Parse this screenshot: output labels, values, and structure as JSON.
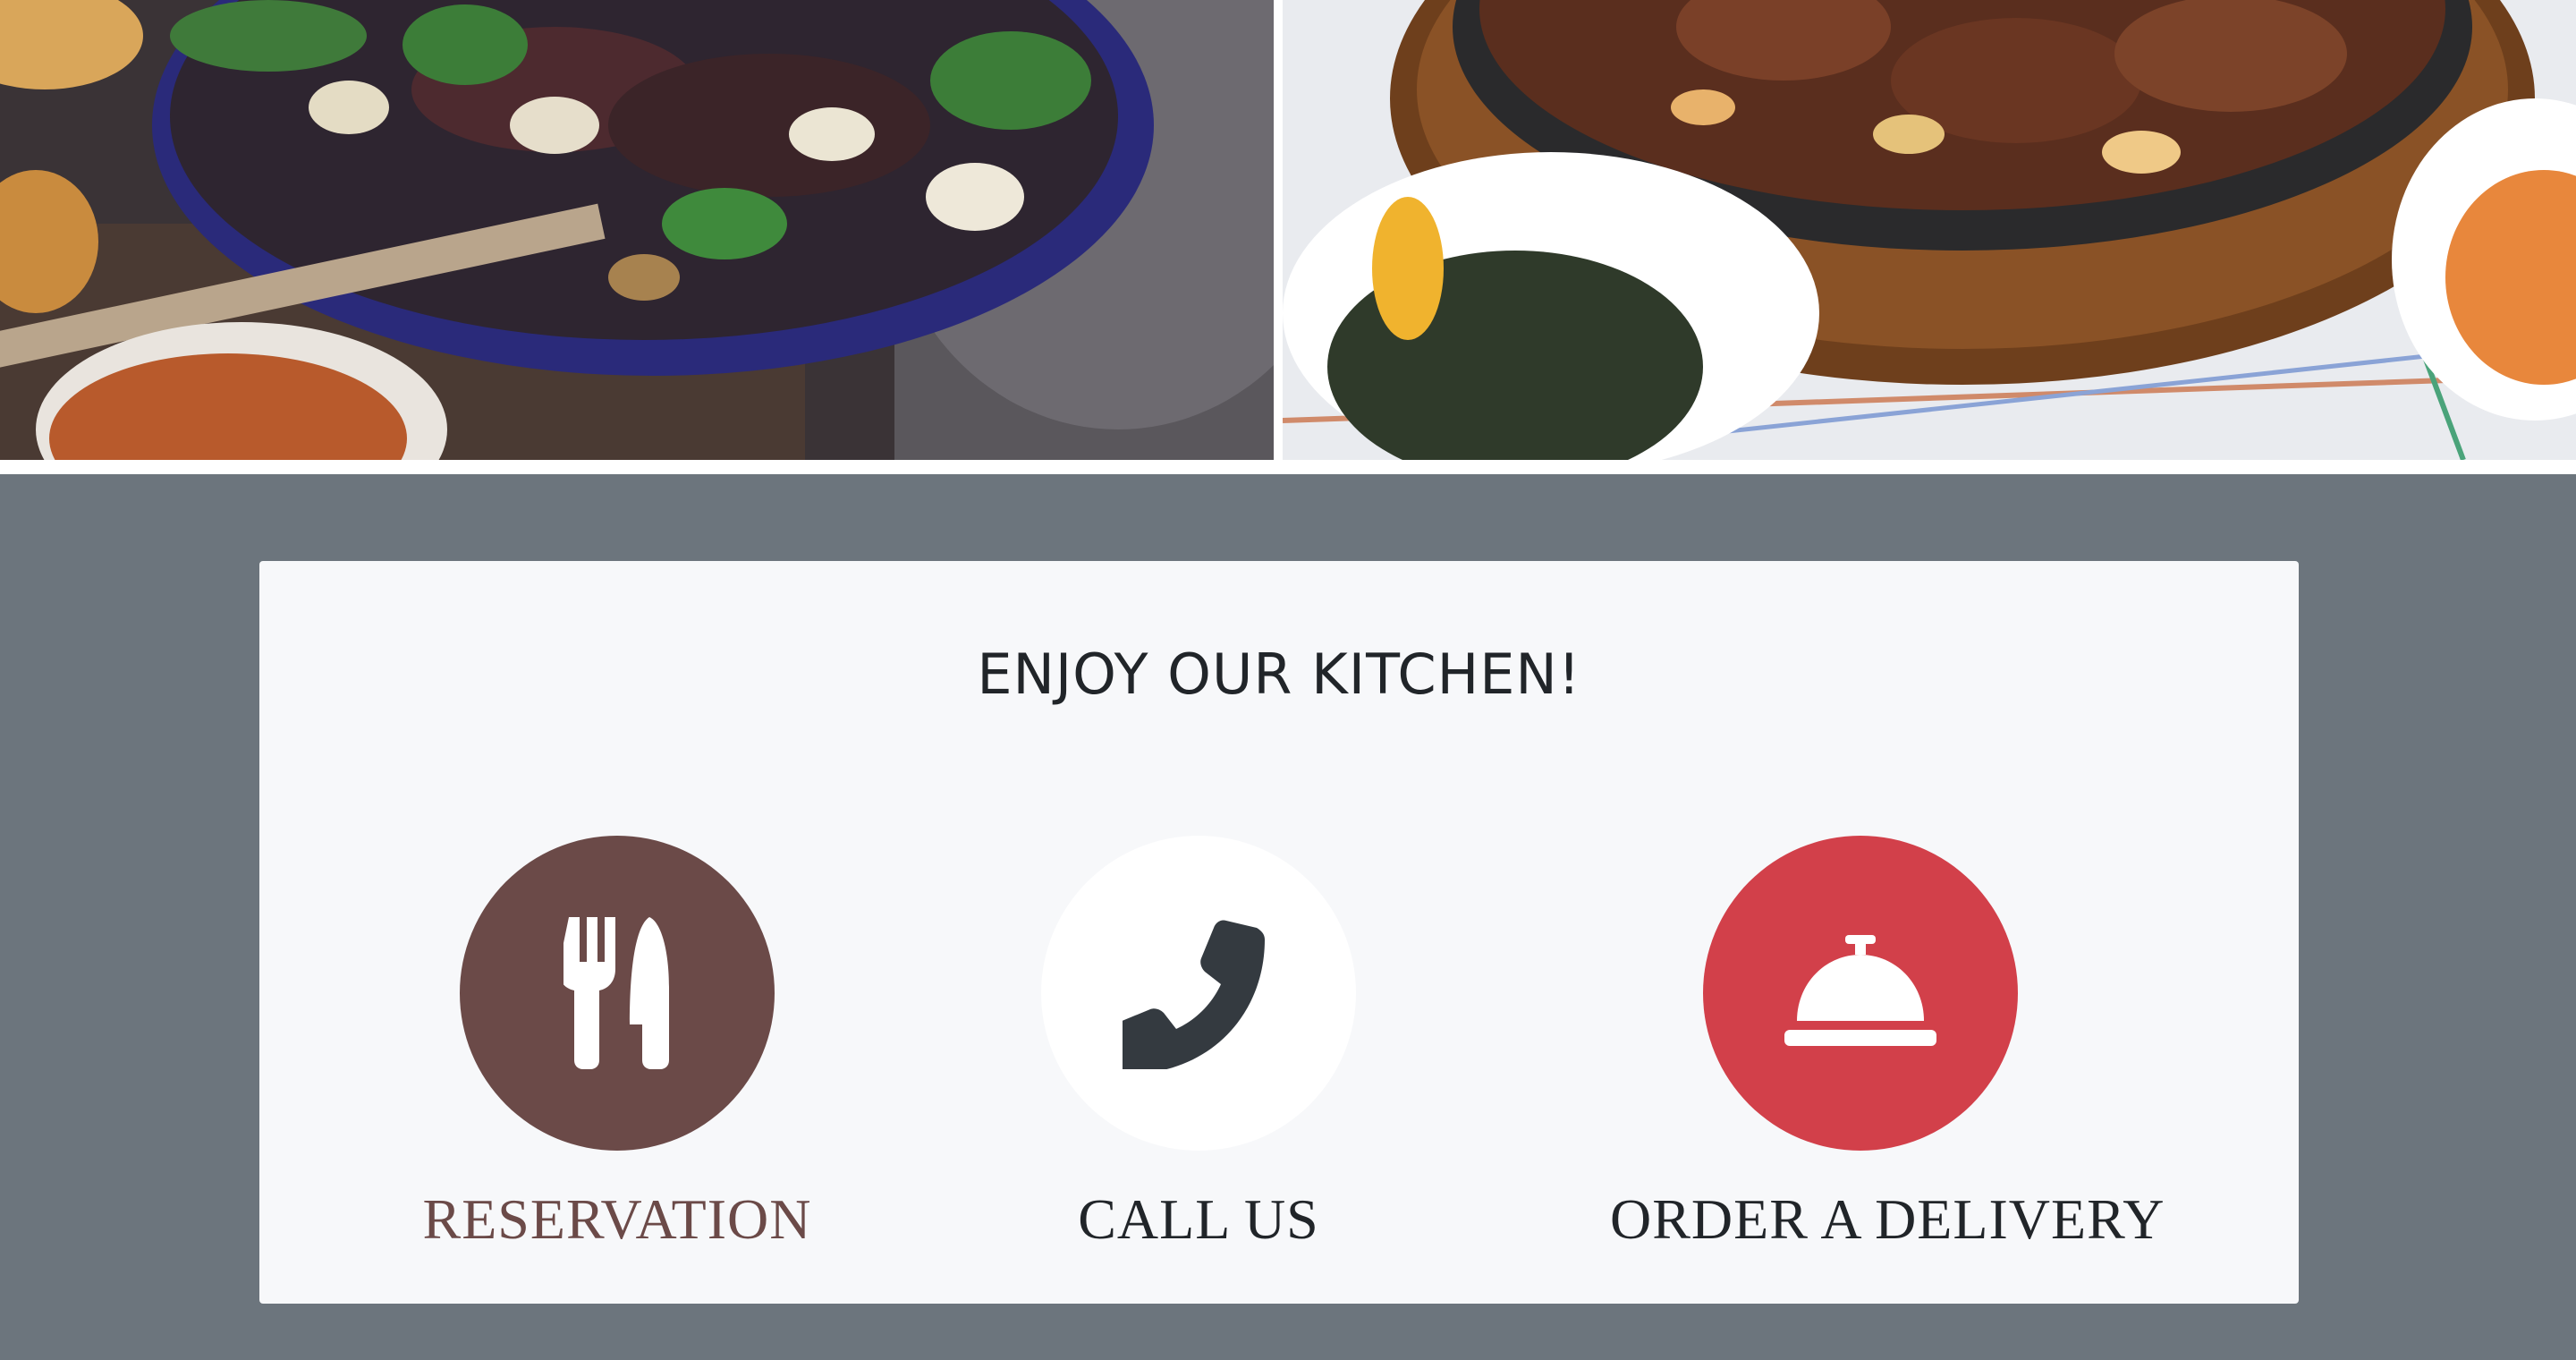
{
  "banner": {
    "left_photo": "salad",
    "right_photo": "sizzling beef"
  },
  "kitchen": {
    "title": "ENJOY OUR KITCHEN!",
    "actions": [
      {
        "label": "RESERVATION",
        "icon": "utensils-icon",
        "circle_color": "#6b4a48",
        "icon_color": "#ffffff",
        "label_color": "#6b4a48"
      },
      {
        "label": "CALL US",
        "icon": "phone-icon",
        "circle_color": "#ffffff",
        "icon_color": "#343a40",
        "label_color": "#212529"
      },
      {
        "label": "ORDER A DELIVERY",
        "icon": "concierge-bell-icon",
        "circle_color": "#d2404a",
        "icon_color": "#ffffff",
        "label_color": "#212529"
      }
    ]
  },
  "colors": {
    "page_background": "#6c757d",
    "panel_background": "#f7f8fa"
  }
}
